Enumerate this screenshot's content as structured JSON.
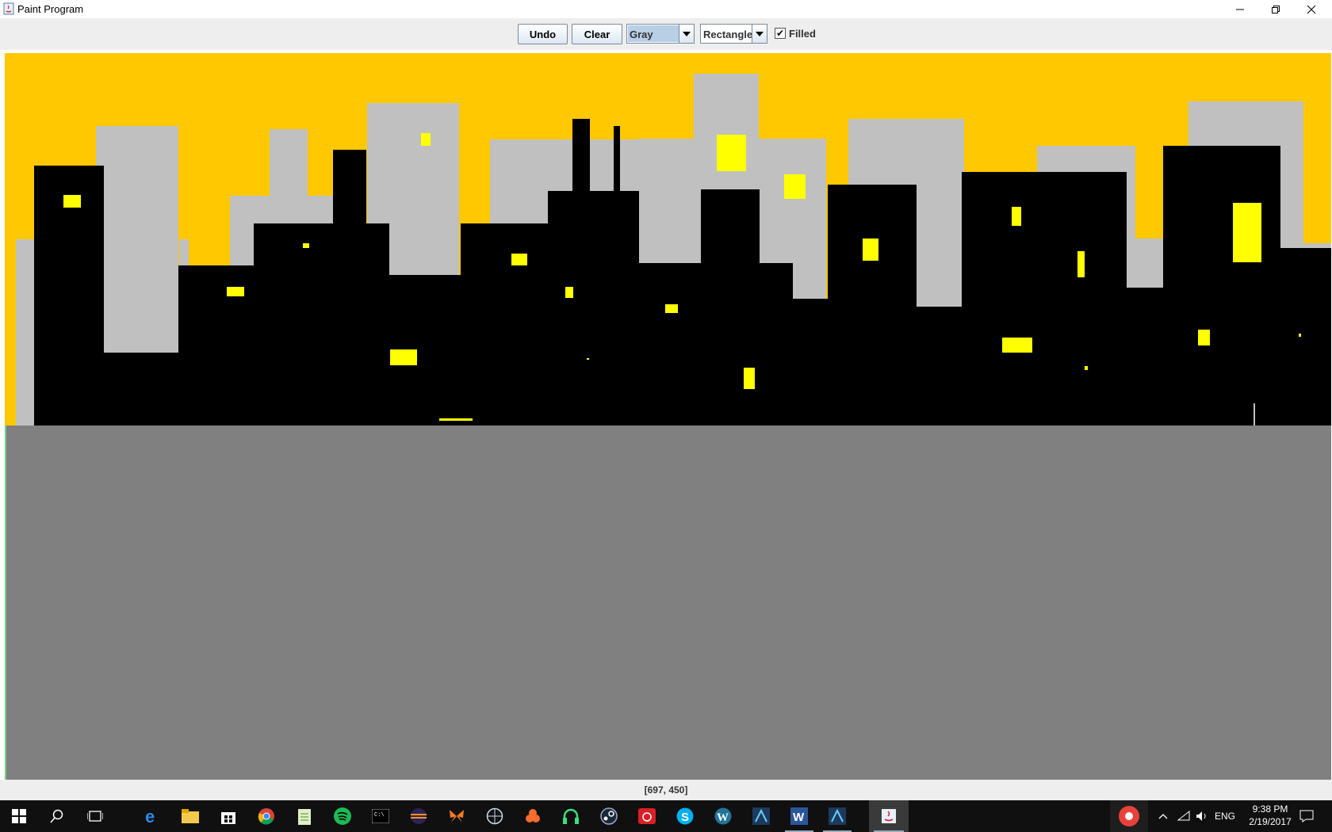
{
  "window": {
    "title": "Paint Program",
    "icons": [
      "java-icon",
      "minimize-icon",
      "maximize-icon",
      "close-icon"
    ]
  },
  "toolbar": {
    "undo_label": "Undo",
    "clear_label": "Clear",
    "color_value": "Gray",
    "shape_value": "Rectangle",
    "filled_label": "Filled",
    "filled_checked": true
  },
  "canvas": {
    "colors": {
      "sky": "#ffc800",
      "far_buildings": "#c0c0c0",
      "near_buildings": "#000000",
      "windows": "#ffff00",
      "ground": "#808080"
    }
  },
  "status": {
    "coords": "[697, 450]"
  },
  "taskbar": {
    "apps": [
      "start-icon",
      "search-icon",
      "task-view-icon",
      "edge-icon",
      "file-explorer-icon",
      "store-icon",
      "chrome-icon",
      "notepad-icon",
      "spotify-icon",
      "terminal-icon",
      "eclipse-icon",
      "butterfly-icon",
      "globe-icon",
      "origin-icon",
      "headphones-icon",
      "steam-icon",
      "creative-cloud-icon",
      "skype-icon",
      "wordpress-icon",
      "app-icon",
      "word-icon",
      "app2-icon",
      "java-icon"
    ],
    "tray": {
      "lang": "ENG",
      "time": "9:38 PM",
      "date": "2/19/2017"
    }
  }
}
